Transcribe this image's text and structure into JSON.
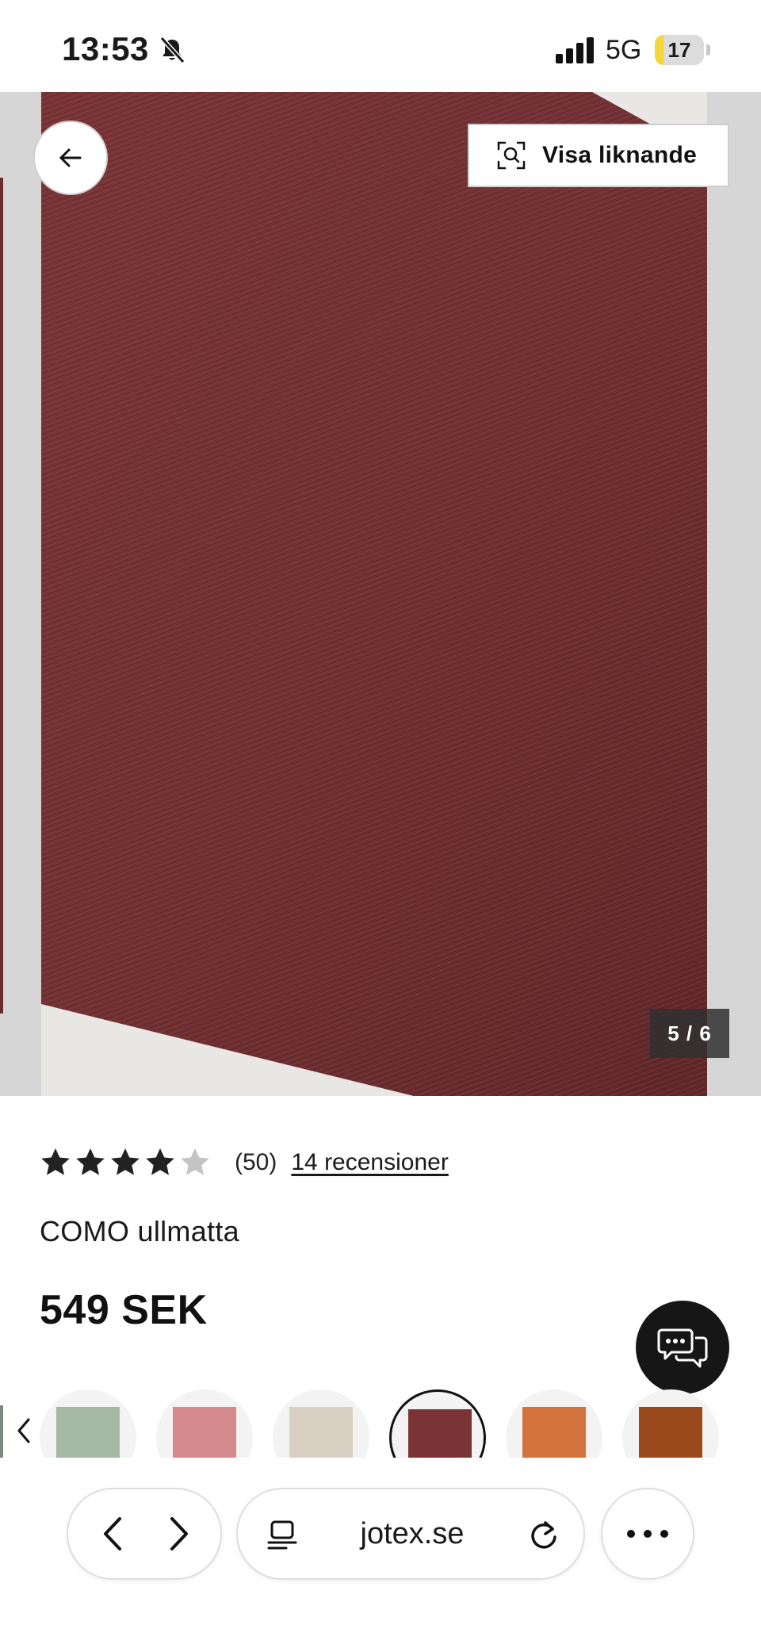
{
  "status_bar": {
    "time": "13:53",
    "network": "5G",
    "battery_level": "17",
    "battery_fraction": 0.17,
    "icons": [
      "bell-muted-icon",
      "cellular-signal-icon",
      "battery-icon"
    ]
  },
  "gallery": {
    "similar_label": "Visa liknande",
    "counter": "5 / 6",
    "icons": [
      "arrow-left-icon",
      "visual-search-icon"
    ],
    "rug_color": "#6f2f30"
  },
  "product": {
    "rating_value": 4,
    "rating_max": 5,
    "rating_count": "(50)",
    "reviews_link": "14 recensioner",
    "name": "COMO ullmatta",
    "price": "549 SEK"
  },
  "swatches": [
    {
      "color": "#a4b8a4",
      "selected": false
    },
    {
      "color": "#d48a8c",
      "selected": false
    },
    {
      "color": "#d8d0c2",
      "selected": false
    },
    {
      "color": "#7a3436",
      "selected": true
    },
    {
      "color": "#d2733e",
      "selected": false
    },
    {
      "color": "#9a4a1c",
      "selected": false
    }
  ],
  "browser": {
    "url": "jotex.se",
    "icons": [
      "chevron-left-icon",
      "chevron-right-icon",
      "reader-icon",
      "reload-icon",
      "more-icon"
    ]
  },
  "colors": {
    "star_filled": "#222222",
    "star_empty": "#c4c4c4",
    "battery_yellow": "#f5d73a",
    "chat_background": "#161616"
  }
}
